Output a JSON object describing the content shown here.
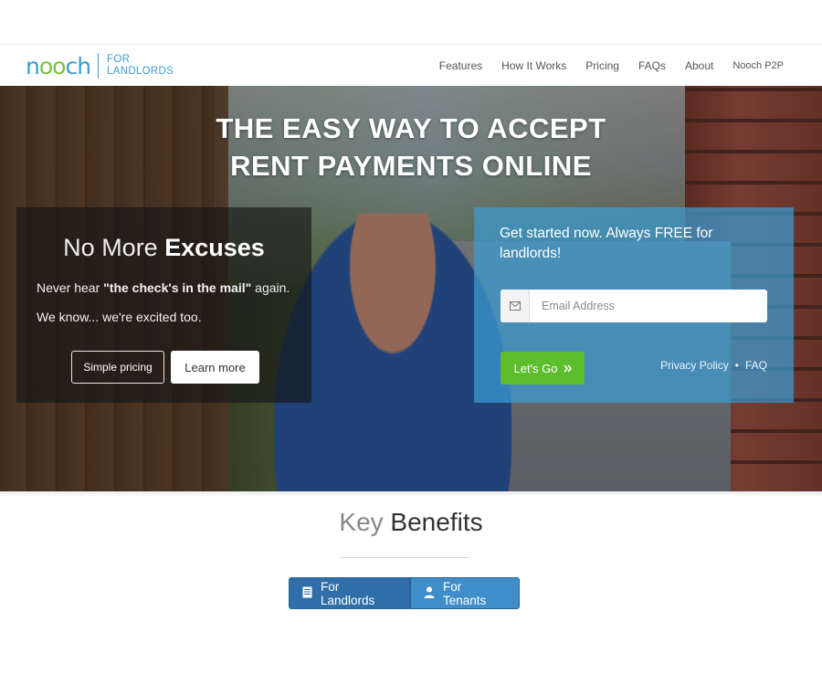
{
  "brand": {
    "logo_text": "nooch",
    "sub_line1": "FOR",
    "sub_line2": "LANDLORDS",
    "primary_color": "#3b9bd3",
    "accent_color": "#7ac043"
  },
  "nav": {
    "items": [
      {
        "label": "Features"
      },
      {
        "label": "How It Works"
      },
      {
        "label": "Pricing"
      },
      {
        "label": "FAQs"
      },
      {
        "label": "About"
      },
      {
        "label": "Nooch P2P"
      }
    ]
  },
  "hero": {
    "title_line1": "THE EASY WAY TO ACCEPT",
    "title_line2": "RENT PAYMENTS ONLINE",
    "left": {
      "heading_thin": "No More",
      "heading_bold": "Excuses",
      "line1_prefix": "Never hear",
      "line1_bold": "\"the check's in the mail\"",
      "line1_suffix": "again.",
      "line2": "We know... we're excited too.",
      "btn_simple_pricing": "Simple pricing",
      "btn_learn_more": "Learn more"
    },
    "right": {
      "heading": "Get started now. Always FREE for landlords!",
      "email_placeholder": "Email Address",
      "btn_go": "Let's Go",
      "link_privacy": "Privacy Policy",
      "link_sep": "•",
      "link_faq": "FAQ",
      "panel_color": "#3c9bd2",
      "go_color": "#5cbd2d"
    }
  },
  "benefits": {
    "title_light": "Key",
    "title_dark": "Benefits",
    "tab_landlords": "For Landlords",
    "tab_tenants": "For Tenants"
  },
  "icons": {
    "envelope": "envelope-icon",
    "double_chevron": "double-chevron-right-icon",
    "document": "document-icon",
    "user": "user-icon"
  }
}
